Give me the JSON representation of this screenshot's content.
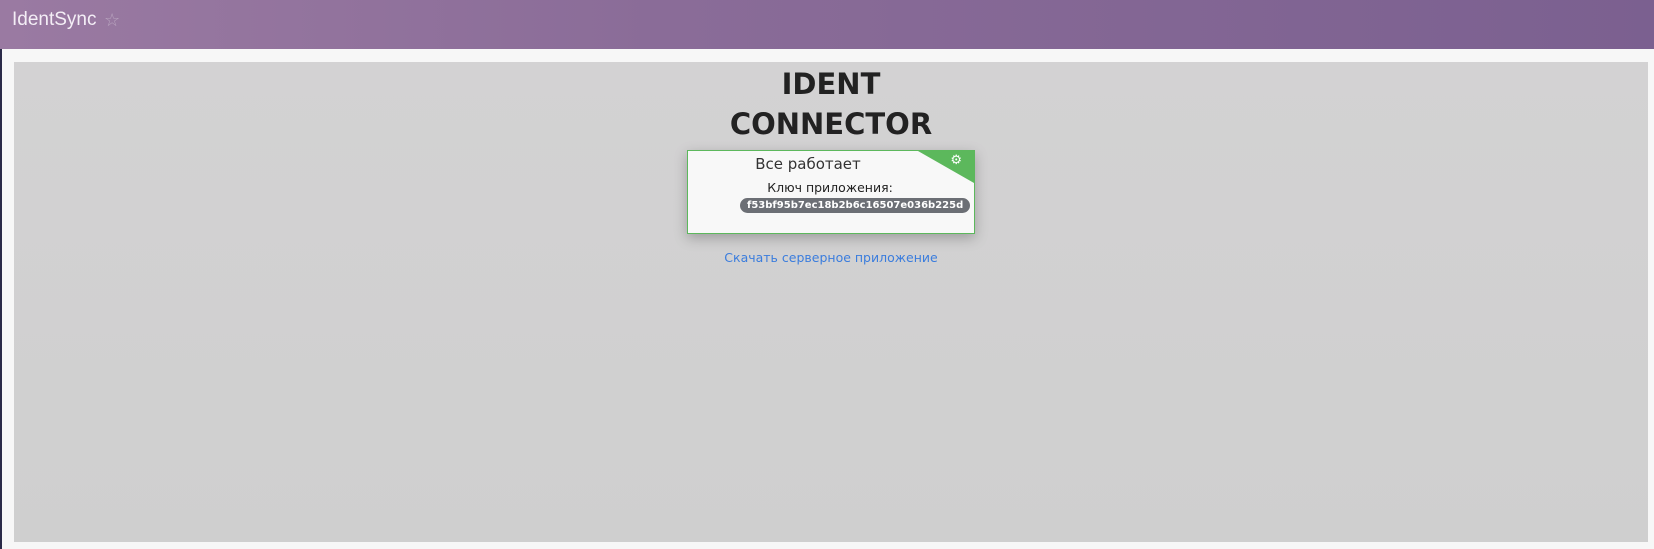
{
  "header": {
    "app_title": "IdentSync",
    "favorite_icon": "star-icon"
  },
  "main": {
    "title_line1": "IDENT",
    "title_line2": "CONNECTOR",
    "card": {
      "status": "Все работает",
      "key_label": "Ключ приложения:",
      "key_value": "f53bf95b7ec18b2b6c16507e036b225d",
      "settings_icon": "gear-icon",
      "status_color": "#5cb85c"
    },
    "download_link": "Скачать серверное приложение"
  }
}
